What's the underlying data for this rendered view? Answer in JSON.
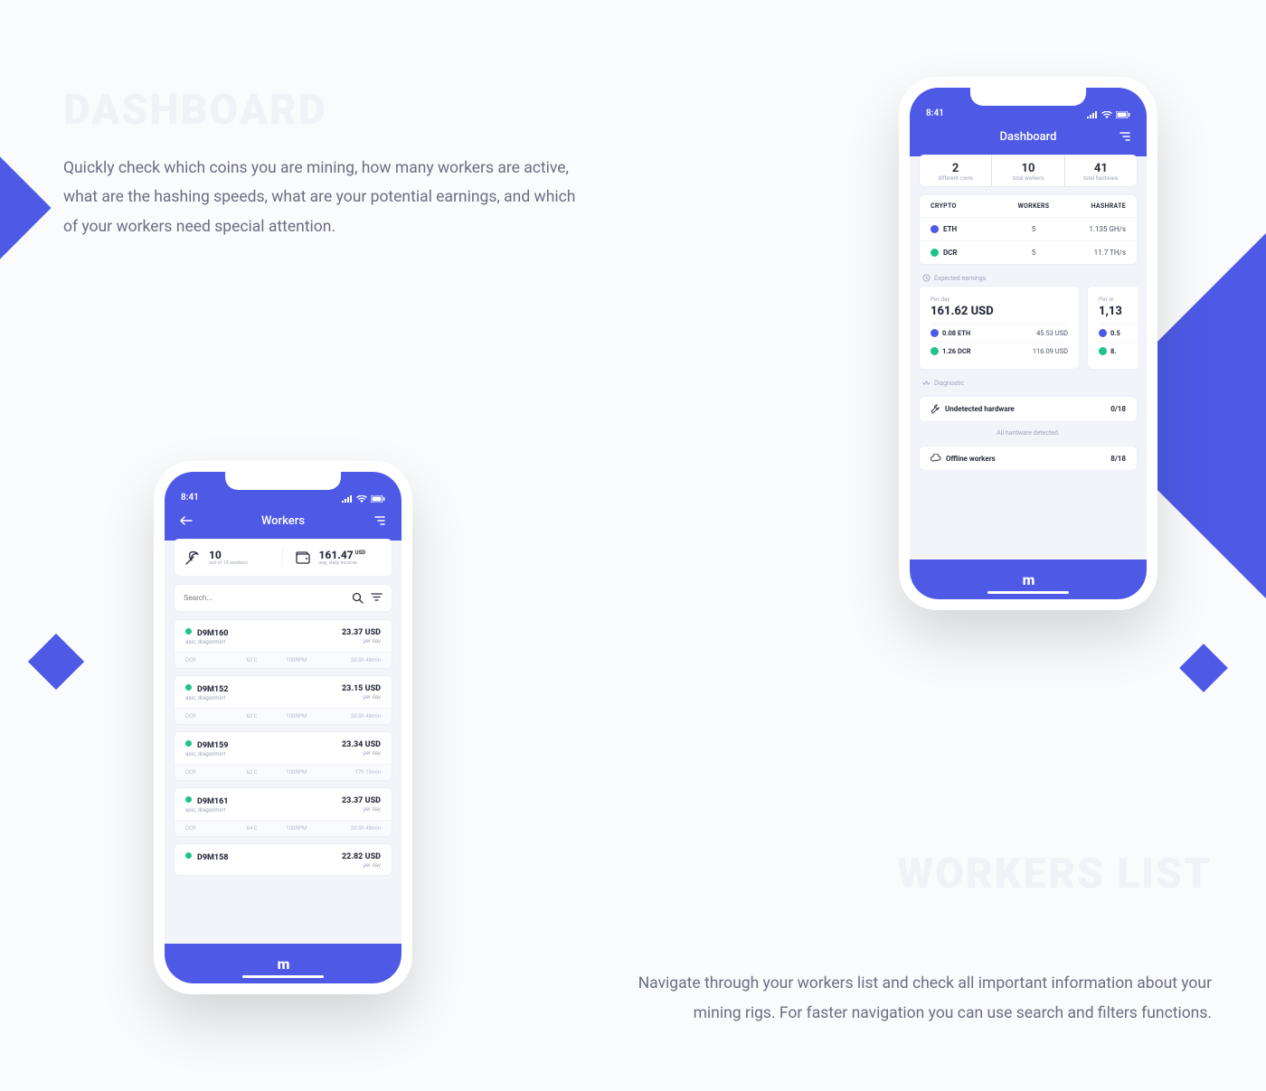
{
  "page": {
    "dashboard_heading": "DASHBOARD",
    "dashboard_desc": "Quickly check which coins you are mining, how many workers are active, what are the hashing speeds, what are your potential earnings, and which of your workers need special attention.",
    "workers_heading": "WORKERS LIST",
    "workers_desc": "Navigate through your workers list and check all important information about your mining rigs. For faster navigation you can use search and filters functions."
  },
  "status": {
    "time": "8:41"
  },
  "dashboard": {
    "title": "Dashboard",
    "tabs": [
      {
        "num": "2",
        "label": "different coins"
      },
      {
        "num": "10",
        "label": "total workers"
      },
      {
        "num": "41",
        "label": "total hardware"
      }
    ],
    "table": {
      "headers": {
        "c1": "CRYPTO",
        "c2": "WORKERS",
        "c3": "HASHRATE"
      },
      "rows": [
        {
          "coin": "ETH",
          "cls": "eth",
          "workers": "5",
          "hashrate": "1.135 GH/s"
        },
        {
          "coin": "DCR",
          "cls": "dcr",
          "workers": "5",
          "hashrate": "11.7 TH/s"
        }
      ]
    },
    "earnings": {
      "label": "Expected earnings",
      "cards": [
        {
          "period": "Per day",
          "amount": "161.62 USD",
          "lines": [
            {
              "coin": "ETH",
              "cls": "eth",
              "qty": "0.08 ETH",
              "usd": "45.53 USD"
            },
            {
              "coin": "DCR",
              "cls": "dcr",
              "qty": "1.26 DCR",
              "usd": "116.09 USD"
            }
          ]
        },
        {
          "period": "Per w",
          "amount": "1,13",
          "lines": [
            {
              "coin": "ETH",
              "cls": "eth",
              "qty": "0.5",
              "usd": ""
            },
            {
              "coin": "DCR",
              "cls": "dcr",
              "qty": "8.",
              "usd": ""
            }
          ]
        }
      ]
    },
    "diagnostic": {
      "label": "Diagnostic",
      "undetected": {
        "label": "Undetected hardware",
        "value": "0/18"
      },
      "msg": "All hardware detected.",
      "offline": {
        "label": "Offline workers",
        "value": "8/18"
      }
    }
  },
  "workers": {
    "title": "Workers",
    "summary": {
      "active": {
        "value": "10",
        "sub": "out of 18 workers"
      },
      "income": {
        "value": "161.47",
        "currency": "USD",
        "sub": "avg. daily income"
      }
    },
    "search_placeholder": "Search...",
    "perday_label": "per day",
    "list": [
      {
        "name": "D9M160",
        "tags": "asic, dragonmint",
        "amount": "23.37 USD",
        "coin": "DCR",
        "temp": "62 C",
        "rpm": "100RPM",
        "uptime": "2d 5h 48min"
      },
      {
        "name": "D9M152",
        "tags": "asic, dragonmint",
        "amount": "23.15 USD",
        "coin": "DCR",
        "temp": "62 C",
        "rpm": "100RPM",
        "uptime": "2d 5h 48min"
      },
      {
        "name": "D9M159",
        "tags": "asic, dragonmint",
        "amount": "23.34 USD",
        "coin": "DCR",
        "temp": "62 C",
        "rpm": "100RPM",
        "uptime": "17h 15min"
      },
      {
        "name": "D9M161",
        "tags": "asic, dragonmint",
        "amount": "23.37 USD",
        "coin": "DCR",
        "temp": "64 C",
        "rpm": "100RPM",
        "uptime": "2d 5h 48min"
      },
      {
        "name": "D9M158",
        "tags": "",
        "amount": "22.82 USD",
        "coin": "",
        "temp": "",
        "rpm": "",
        "uptime": ""
      }
    ]
  }
}
